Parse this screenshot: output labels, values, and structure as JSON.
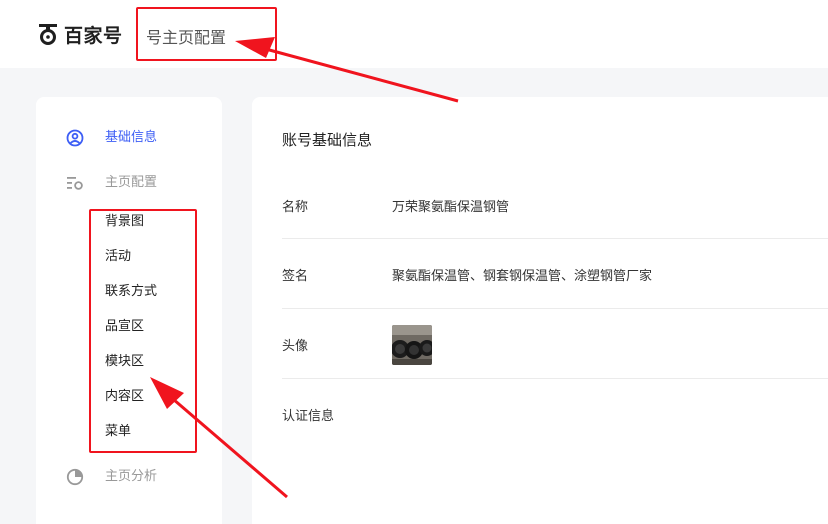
{
  "header": {
    "logo_text": "百家号",
    "title": "号主页配置"
  },
  "sidebar": {
    "items": [
      {
        "label": "基础信息",
        "icon": "user-circle-icon",
        "state": "active"
      },
      {
        "label": "主页配置",
        "icon": "settings-list-icon",
        "state": "muted"
      },
      {
        "label": "主页分析",
        "icon": "pie-chart-icon",
        "state": "muted"
      }
    ],
    "subitems": [
      "背景图",
      "活动",
      "联系方式",
      "品宣区",
      "模块区",
      "内容区",
      "菜单"
    ]
  },
  "main": {
    "section_title": "账号基础信息",
    "rows": [
      {
        "label": "名称",
        "value": "万荣聚氨酯保温钢管"
      },
      {
        "label": "签名",
        "value": "聚氨酯保温管、钢套钢保温管、涂塑钢管厂家"
      },
      {
        "label": "头像",
        "value": ""
      },
      {
        "label": "认证信息",
        "value": ""
      }
    ]
  },
  "colors": {
    "accent": "#3d5ef5",
    "annotation": "#f0141e",
    "muted_text": "#999999"
  }
}
